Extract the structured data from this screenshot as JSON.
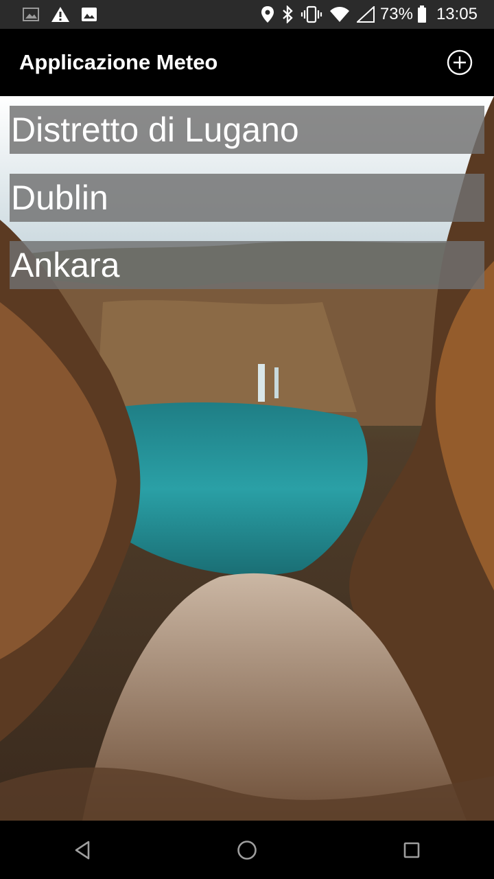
{
  "status_bar": {
    "battery_percent": "73%",
    "time": "13:05",
    "left_icons": [
      "image-notification-icon",
      "warning-icon",
      "image-icon"
    ],
    "right_icons": [
      "location-icon",
      "bluetooth-icon",
      "vibrate-icon",
      "wifi-icon",
      "signal-icon",
      "battery-icon"
    ]
  },
  "app_bar": {
    "title": "Applicazione Meteo",
    "add_icon": "add-circle-icon"
  },
  "cities": [
    {
      "name": "Distretto di Lugano"
    },
    {
      "name": "Dublin"
    },
    {
      "name": "Ankara"
    }
  ],
  "nav_bar": {
    "icons": [
      "back-icon",
      "home-icon",
      "recents-icon"
    ]
  },
  "colors": {
    "app_bar_bg": "#000000",
    "status_bar_bg": "#2b2b2b",
    "list_item_bg": "#707070",
    "text": "#ffffff"
  }
}
